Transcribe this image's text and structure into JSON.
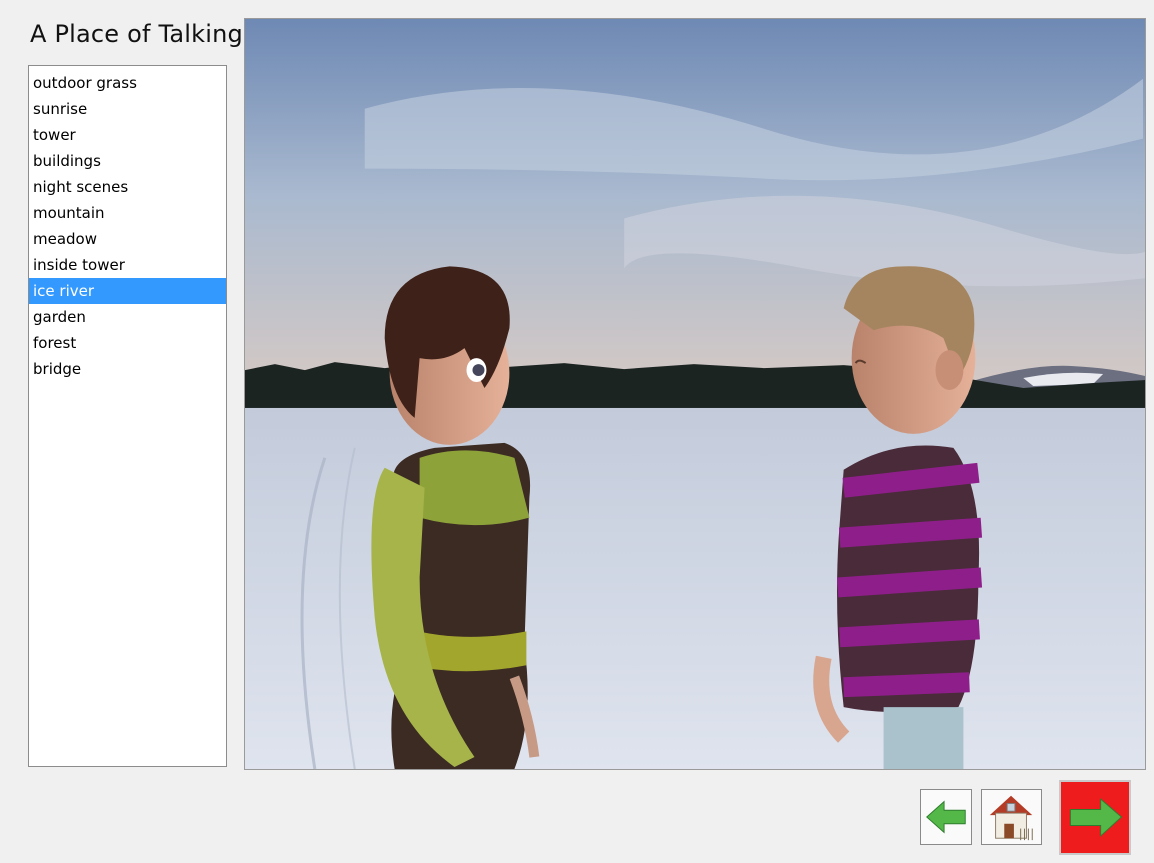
{
  "app": {
    "title": "A Place of Talking"
  },
  "scenes": {
    "items": [
      {
        "label": "outdoor grass"
      },
      {
        "label": "sunrise"
      },
      {
        "label": "tower"
      },
      {
        "label": "buildings"
      },
      {
        "label": "night scenes"
      },
      {
        "label": "mountain"
      },
      {
        "label": "meadow"
      },
      {
        "label": "inside tower"
      },
      {
        "label": "ice river",
        "selected": true
      },
      {
        "label": "garden"
      },
      {
        "label": "forest"
      },
      {
        "label": "bridge"
      }
    ],
    "selected_color": "#3399ff"
  },
  "navigation": {
    "back_icon": "green-left-arrow-icon",
    "home_icon": "house-icon",
    "next_icon": "green-right-arrow-icon",
    "next_background": "#ee1c1c"
  }
}
